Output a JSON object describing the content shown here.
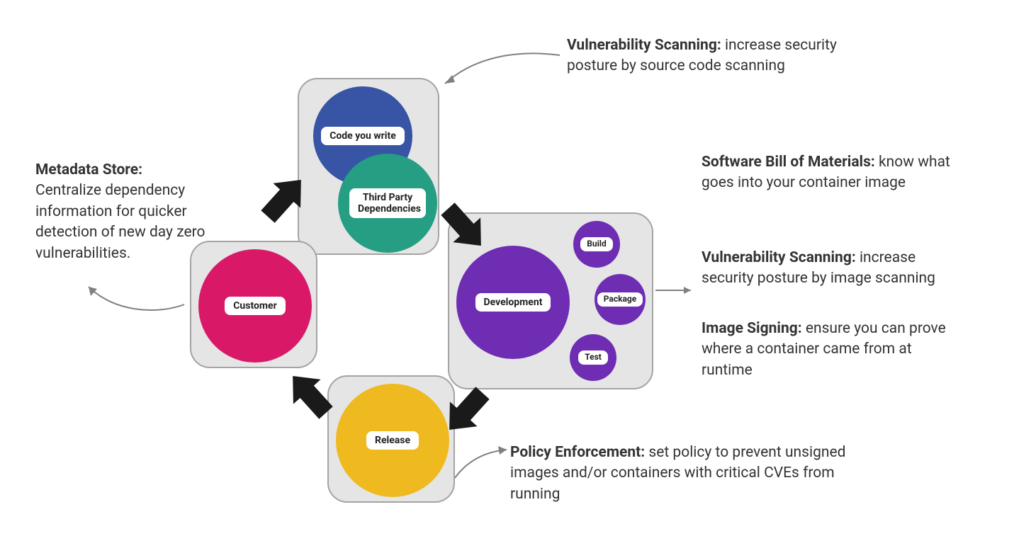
{
  "stages": {
    "code": {
      "circle1": "Code you write",
      "circle2": "Third Party\nDependencies"
    },
    "development": {
      "main": "Development",
      "sub1": "Build",
      "sub2": "Package",
      "sub3": "Test"
    },
    "release": {
      "circle": "Release"
    },
    "customer": {
      "circle": "Customer"
    }
  },
  "annotations": {
    "top": {
      "bold": "Vulnerability Scanning:",
      "text": " increase security posture by source code scanning"
    },
    "right1": {
      "bold": "Software Bill of Materials:",
      "text": " know what goes into your container image"
    },
    "right2": {
      "bold": "Vulnerability Scanning:",
      "text": " increase security posture by image scanning"
    },
    "right3": {
      "bold": "Image Signing:",
      "text": " ensure you can prove where a container came from at runtime"
    },
    "bottom": {
      "bold": "Policy Enforcement:",
      "text": " set policy to prevent unsigned images and/or containers with critical CVEs from running"
    },
    "left": {
      "bold": "Metadata Store:",
      "text": "Centralize dependency information for quicker detection of new day zero vulnerabilities."
    }
  },
  "colors": {
    "blue": "#3754a5",
    "teal": "#259e83",
    "purple": "#6e2db3",
    "yellow": "#efba1f",
    "magenta": "#d91968",
    "arrow": "#1a1a1a",
    "connector": "#808080"
  }
}
